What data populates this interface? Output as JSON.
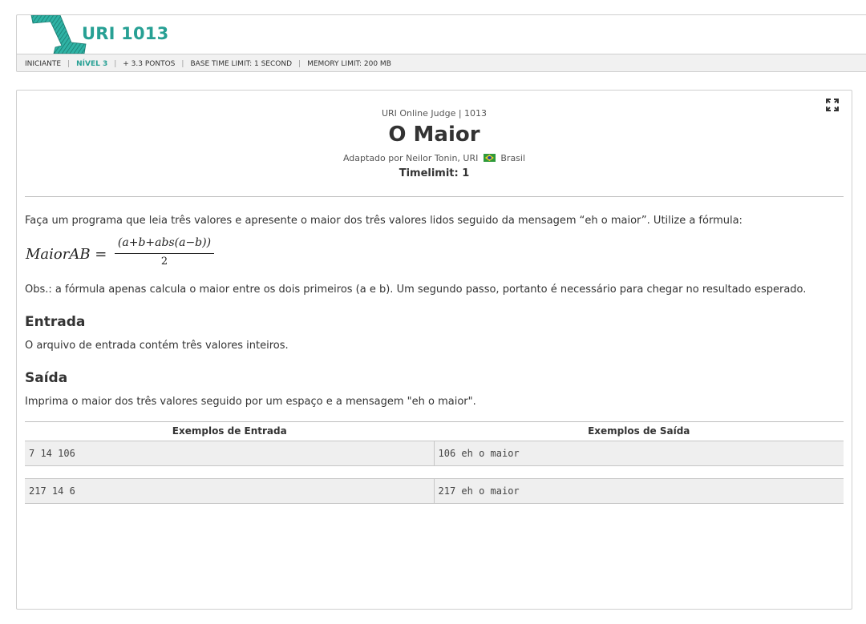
{
  "header": {
    "problem_code": "URI 1013",
    "meta": {
      "category": "INICIANTE",
      "level": "NÍVEL 3",
      "points": "+ 3.3 PONTOS",
      "base_time": "BASE TIME LIMIT: 1 SECOND",
      "memory": "MEMORY LIMIT: 200 MB"
    },
    "logo_icon": "level-number-icon",
    "accent_color": "#27a094"
  },
  "problem": {
    "source": "URI Online Judge | 1013",
    "title": "O Maior",
    "author": "Adaptado por Neilor Tonin, URI",
    "country": "Brasil",
    "timelimit": "Timelimit: 1",
    "description": "Faça um programa que leia três valores e apresente o maior dos três valores lidos seguido da mensagem “eh o maior”. Utilize a fórmula:",
    "formula": {
      "lhs": "MaiorAB =",
      "numerator": "(a+b+abs(a−b))",
      "denominator": "2"
    },
    "obs": "Obs.: a fórmula apenas calcula o maior entre os dois primeiros (a e b). Um segundo passo, portanto é necessário para chegar no resultado esperado.",
    "input_title": "Entrada",
    "input_text": "O arquivo de entrada contém três valores inteiros.",
    "output_title": "Saída",
    "output_text": "Imprima o maior dos três valores seguido por um espaço e a mensagem \"eh o maior\"."
  },
  "examples": {
    "input_header": "Exemplos de Entrada",
    "output_header": "Exemplos de Saída",
    "rows": [
      {
        "input": "7 14 106",
        "output": "106 eh o maior"
      },
      {
        "input": "217 14 6",
        "output": "217 eh o maior"
      }
    ]
  }
}
